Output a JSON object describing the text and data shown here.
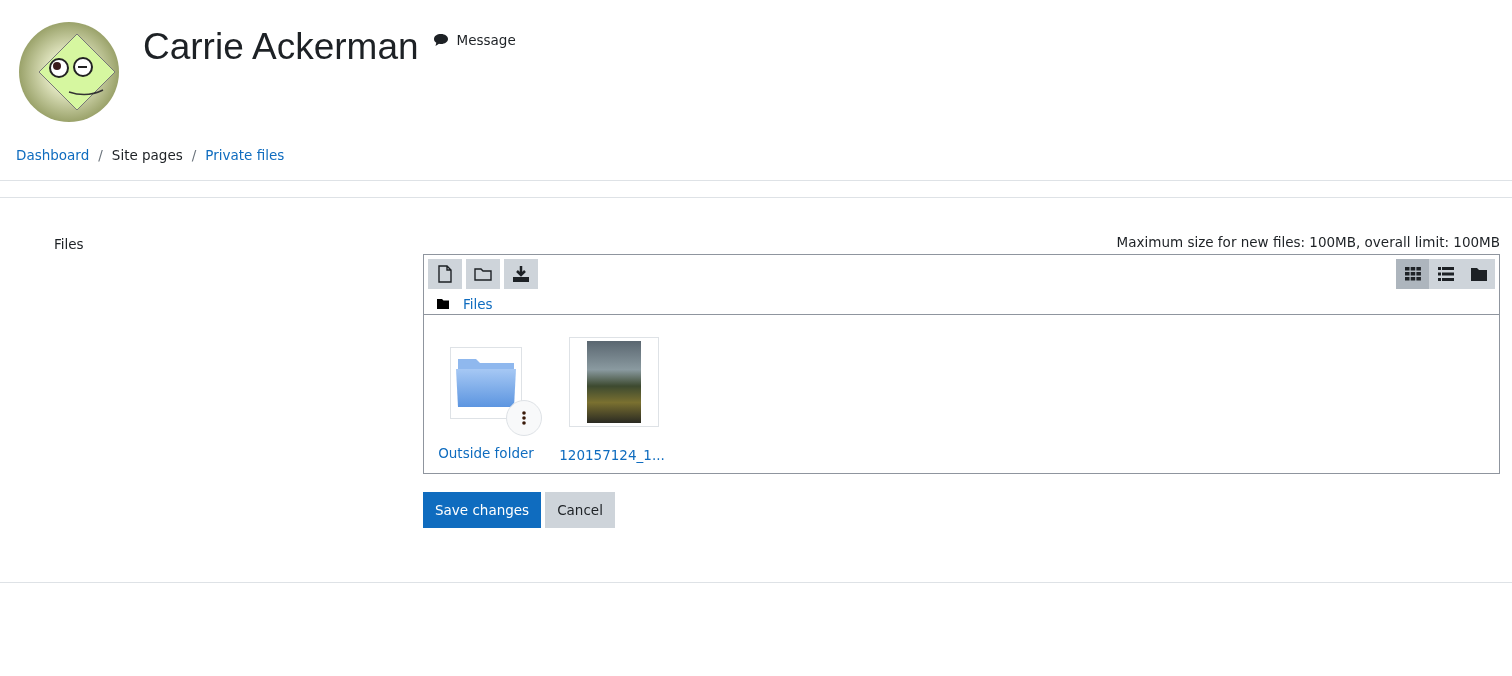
{
  "profile": {
    "name": "Carrie Ackerman",
    "message_link": "Message"
  },
  "breadcrumb": [
    {
      "kind": "link",
      "label": "Dashboard"
    },
    {
      "kind": "separator",
      "label": "/"
    },
    {
      "kind": "text",
      "label": "Site pages"
    },
    {
      "kind": "separator",
      "label": "/"
    },
    {
      "kind": "link",
      "label": "Private files"
    }
  ],
  "form": {
    "label": "Files",
    "limit_note": "Maximum size for new files: 100MB, overall limit: 100MB",
    "toolbar": [
      {
        "kind": "file"
      },
      {
        "kind": "folder"
      },
      {
        "kind": "download"
      }
    ],
    "view_modes": [
      {
        "kind": "grid",
        "selected": true
      },
      {
        "kind": "list",
        "selected": false
      },
      {
        "kind": "tree",
        "selected": false
      }
    ],
    "path": "Files",
    "items": [
      {
        "kind": "folder",
        "name": "Outside folder"
      },
      {
        "kind": "image",
        "name": "120157124_1..."
      }
    ],
    "buttons": [
      {
        "kind": "primary",
        "label": "Save changes"
      },
      {
        "kind": "secondary",
        "label": "Cancel"
      }
    ]
  }
}
